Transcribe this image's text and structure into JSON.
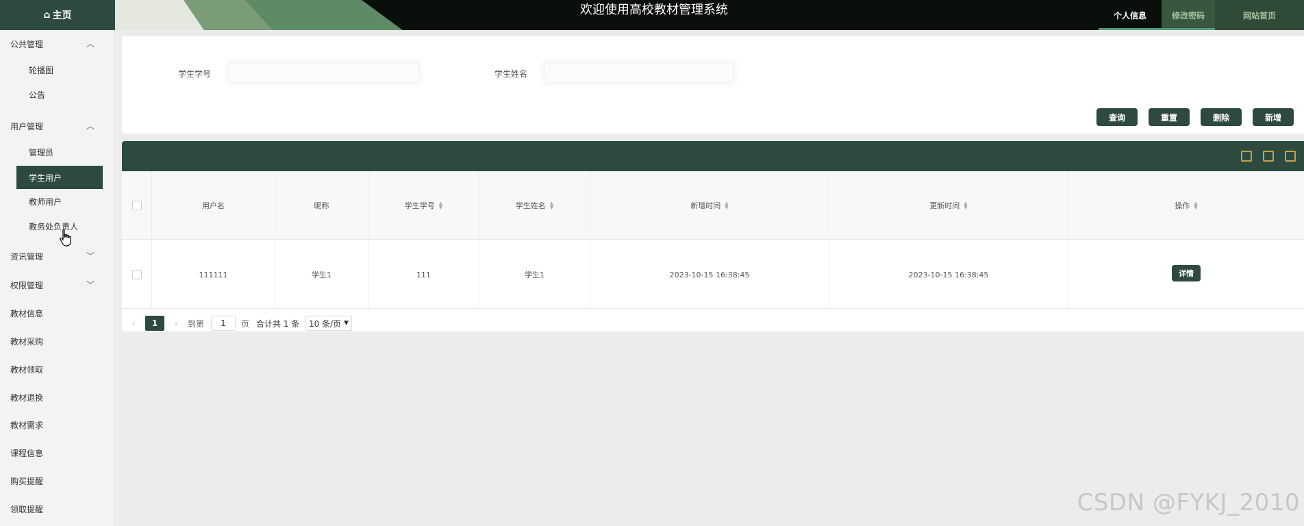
{
  "header": {
    "home_label": "主页",
    "title": "欢迎使用高校教材管理系统",
    "tabs": [
      {
        "label": "个人信息"
      },
      {
        "label": "修改密码"
      },
      {
        "label": "网站首页"
      }
    ]
  },
  "sidebar": {
    "groups": [
      {
        "label": "公共管理",
        "expanded": true
      },
      {
        "label": "用户管理",
        "expanded": true
      },
      {
        "label": "资讯管理",
        "expanded": false
      },
      {
        "label": "权限管理",
        "expanded": false
      }
    ],
    "sub_items": [
      {
        "label": "轮播图"
      },
      {
        "label": "公告"
      },
      {
        "label": "管理员"
      },
      {
        "label": "学生用户"
      },
      {
        "label": "教师用户"
      },
      {
        "label": "教务处负责人"
      }
    ],
    "top_items": [
      {
        "label": "教材信息"
      },
      {
        "label": "教材采购"
      },
      {
        "label": "教材领取"
      },
      {
        "label": "教材退换"
      },
      {
        "label": "教材需求"
      },
      {
        "label": "课程信息"
      },
      {
        "label": "购买提醒"
      },
      {
        "label": "领取提醒"
      }
    ],
    "active_item": "学生用户"
  },
  "search": {
    "fields": [
      {
        "label": "学生学号",
        "value": "",
        "placeholder": ""
      },
      {
        "label": "学生姓名",
        "value": "",
        "placeholder": ""
      }
    ],
    "buttons": [
      {
        "label": "查询"
      },
      {
        "label": "重置"
      },
      {
        "label": "删除"
      },
      {
        "label": "新增"
      }
    ]
  },
  "table": {
    "columns": [
      {
        "label": "用户名"
      },
      {
        "label": "昵称"
      },
      {
        "label": "学生学号"
      },
      {
        "label": "学生姓名"
      },
      {
        "label": "新增时间"
      },
      {
        "label": "更新时间"
      },
      {
        "label": "操作"
      }
    ],
    "rows": [
      {
        "username": "111111",
        "nickname": "学生1",
        "student_no": "111",
        "student_name": "学生1",
        "created": "2023-10-15 16:38:45",
        "updated": "2023-10-15 16:38:45",
        "action": "详情"
      }
    ]
  },
  "pagination": {
    "current_page": "1",
    "goto_label": "到第",
    "goto_value": "1",
    "page_suffix": "页",
    "total_text": "合计共 1 条",
    "page_size": "10 条/页"
  },
  "watermark": "CSDN @FYKJ_2010",
  "colors": {
    "accent": "#2e4a3e",
    "topbar": "#0b0f0c",
    "tab_underline": "#4f9e7b",
    "sidebar_bg": "#f3f3f3",
    "page_bg": "#ececec"
  }
}
